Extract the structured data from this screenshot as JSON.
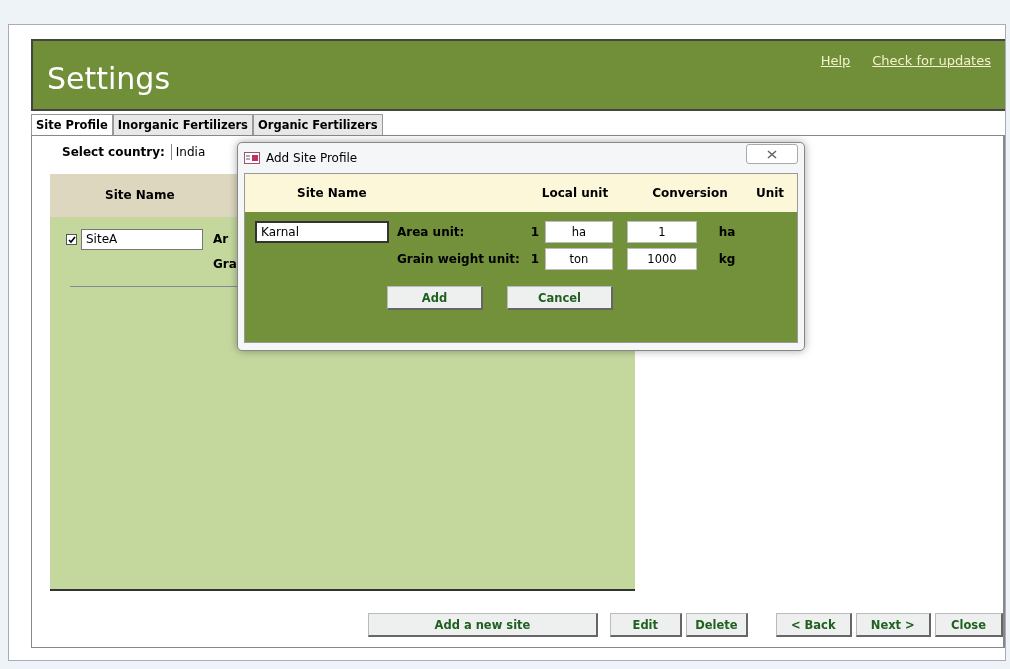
{
  "header": {
    "title": "Settings",
    "links": [
      "Help",
      "Check for updates"
    ]
  },
  "tabs": [
    {
      "label": "Site Profile",
      "selected": true
    },
    {
      "label": "Inorganic Fertilizers",
      "selected": false
    },
    {
      "label": "Organic Fertilizers",
      "selected": false
    }
  ],
  "country": {
    "label": "Select country:",
    "value": "India"
  },
  "sites": {
    "column": "Site Name",
    "rows": [
      {
        "checked": true,
        "name": "SiteA",
        "labels": [
          "Ar",
          "Gra"
        ]
      }
    ]
  },
  "dialog": {
    "title": "Add Site Profile",
    "columns": [
      "Site Name",
      "Local unit",
      "Conversion",
      "Unit"
    ],
    "site_name": "Karnal",
    "units": [
      {
        "label": "Area unit:",
        "count": "1",
        "local": "ha",
        "conversion": "1",
        "unit": "ha"
      },
      {
        "label": "Grain weight unit:",
        "count": "1",
        "local": "ton",
        "conversion": "1000",
        "unit": "kg"
      }
    ],
    "buttons": [
      "Add",
      "Cancel"
    ]
  },
  "buttons": [
    "Add a new site",
    "Edit",
    "Delete",
    "< Back",
    "Next >",
    "Close"
  ]
}
